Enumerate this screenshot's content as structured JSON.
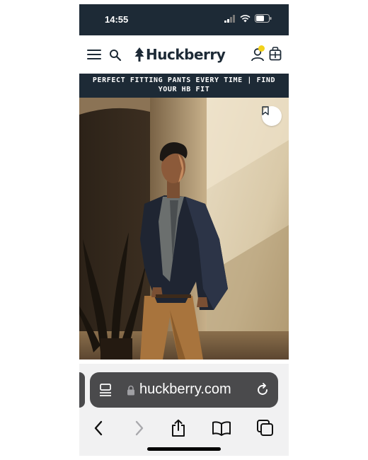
{
  "status_bar": {
    "time": "14:55"
  },
  "header": {
    "brand": "Huckberry",
    "icons": [
      "menu-icon",
      "search-icon",
      "tree-logo-icon",
      "account-icon",
      "cart-icon"
    ],
    "notification_dot_color": "#f2d21b"
  },
  "promo": {
    "text": "PERFECT FITTING PANTS EVERY TIME | FIND YOUR HB FIT"
  },
  "hero": {
    "icons": [
      "bookmark-icon"
    ]
  },
  "browser": {
    "url": "huckberry.com",
    "icons": [
      "reader-icon",
      "lock-icon",
      "reload-icon",
      "back-icon",
      "forward-icon",
      "share-icon",
      "bookmarks-icon",
      "tabs-icon"
    ]
  },
  "colors": {
    "brand_navy": "#1d2a36",
    "toolbar_bg": "#f1f1f2",
    "address_bar_bg": "#4a4a4c"
  }
}
